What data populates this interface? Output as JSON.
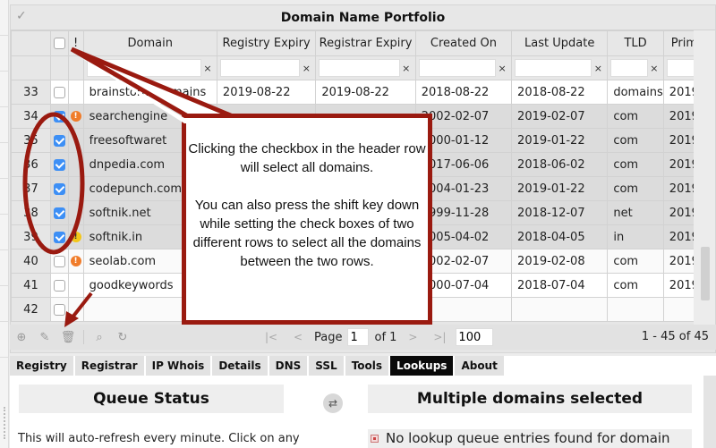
{
  "grid": {
    "title": "Domain Name Portfolio",
    "header_warn": "!",
    "columns": [
      "Domain",
      "Registry Expiry",
      "Registrar Expiry",
      "Created On",
      "Last Update",
      "TLD",
      "Prim"
    ],
    "filter_clear": "×",
    "rows": [
      {
        "num": "33",
        "checked": false,
        "warn": "",
        "domain": "brainstorm.domains",
        "registry_expiry": "2019-08-22",
        "registrar_expiry": "2019-08-22",
        "created": "2018-08-22",
        "updated": "2018-08-22",
        "tld": "domains",
        "prim": "2019-"
      },
      {
        "num": "34",
        "checked": true,
        "warn": "orange",
        "domain": "searchengine",
        "registry_expiry": "",
        "registrar_expiry": "",
        "created": "2002-02-07",
        "updated": "2019-02-07",
        "tld": "com",
        "prim": "2019-"
      },
      {
        "num": "35",
        "checked": true,
        "warn": "",
        "domain": "freesoftwaret",
        "registry_expiry": "",
        "registrar_expiry": "",
        "created": "2000-01-12",
        "updated": "2019-01-22",
        "tld": "com",
        "prim": "2019-"
      },
      {
        "num": "36",
        "checked": true,
        "warn": "",
        "domain": "dnpedia.com",
        "registry_expiry": "",
        "registrar_expiry": "",
        "created": "2017-06-06",
        "updated": "2018-06-02",
        "tld": "com",
        "prim": "2019-"
      },
      {
        "num": "37",
        "checked": true,
        "warn": "",
        "domain": "codepunch.com",
        "registry_expiry": "",
        "registrar_expiry": "",
        "created": "2004-01-23",
        "updated": "2019-01-22",
        "tld": "com",
        "prim": "2019-"
      },
      {
        "num": "38",
        "checked": true,
        "warn": "",
        "domain": "softnik.net",
        "registry_expiry": "",
        "registrar_expiry": "",
        "created": "1999-11-28",
        "updated": "2018-12-07",
        "tld": "net",
        "prim": "2019-"
      },
      {
        "num": "39",
        "checked": true,
        "warn": "yellow",
        "domain": "softnik.in",
        "registry_expiry": "",
        "registrar_expiry": "",
        "created": "2005-04-02",
        "updated": "2018-04-05",
        "tld": "in",
        "prim": "2019-"
      },
      {
        "num": "40",
        "checked": false,
        "warn": "orange",
        "domain": "seolab.com",
        "registry_expiry": "",
        "registrar_expiry": "",
        "created": "2002-02-07",
        "updated": "2019-02-08",
        "tld": "com",
        "prim": "2019-"
      },
      {
        "num": "41",
        "checked": false,
        "warn": "",
        "domain": "goodkeywords",
        "registry_expiry": "",
        "registrar_expiry": "",
        "created": "2000-07-04",
        "updated": "2018-07-04",
        "tld": "com",
        "prim": "2019-"
      },
      {
        "num": "42",
        "checked": false,
        "warn": "",
        "domain": "",
        "registry_expiry": "",
        "registrar_expiry": "",
        "created": "",
        "updated": "",
        "tld": "",
        "prim": ""
      }
    ]
  },
  "toolbar": {
    "icons": [
      "add-icon",
      "edit-icon",
      "delete-icon",
      "search-icon",
      "reload-icon"
    ],
    "page_label": "Page",
    "page_value": "1",
    "of_label": "of 1",
    "page_size": "100",
    "summary": "1 - 45 of 45"
  },
  "tabs": [
    {
      "label": "Registry",
      "active": false
    },
    {
      "label": "Registrar",
      "active": false
    },
    {
      "label": "IP Whois",
      "active": false
    },
    {
      "label": "Details",
      "active": false
    },
    {
      "label": "DNS",
      "active": false
    },
    {
      "label": "SSL",
      "active": false
    },
    {
      "label": "Tools",
      "active": false
    },
    {
      "label": "Lookups",
      "active": true
    },
    {
      "label": "About",
      "active": false
    }
  ],
  "lookups": {
    "queue_title": "Queue Status",
    "queue_text": "This will auto-refresh every minute. Click on any",
    "multi_title": "Multiple domains selected",
    "no_entries": "No lookup queue entries found for domain"
  },
  "callout": {
    "paragraph1": "Clicking the checkbox in the header row will select all domains.",
    "paragraph2": "You can also press the shift key down while setting the check boxes of two different rows to select all the domains between the two rows."
  },
  "colors": {
    "annotation": "#9a1a10",
    "checkbox_checked": "#3d8ff5",
    "warn_orange": "#f07c2a",
    "warn_yellow": "#f3c71a",
    "active_tab": "#0a0a0a"
  }
}
